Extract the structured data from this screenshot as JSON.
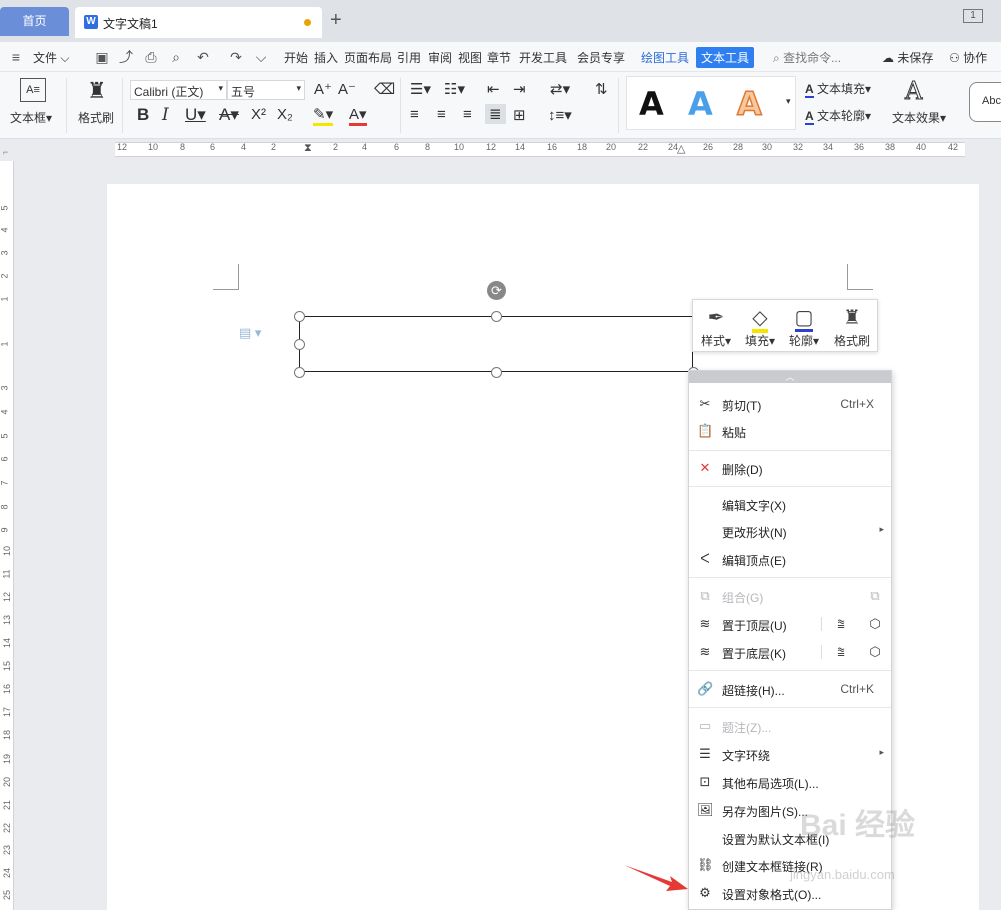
{
  "tabs": {
    "home": "首页",
    "document": "文字文稿1",
    "add": "+",
    "page_indicator": "1"
  },
  "menubar": {
    "file": "文件",
    "items": [
      "开始",
      "插入",
      "页面布局",
      "引用",
      "审阅",
      "视图",
      "章节",
      "开发工具",
      "会员专享"
    ],
    "drawing_tools": "绘图工具",
    "text_tools": "文本工具",
    "search": "查找命令...",
    "unsaved": "未保存",
    "collab": "协作"
  },
  "ribbon": {
    "textbox_label": "文本框",
    "format_painter_label": "格式刷",
    "font_name": "Calibri (正文)",
    "font_size": "五号",
    "text_fill": "文本填充",
    "text_outline": "文本轮廓",
    "text_effect": "文本效果",
    "style_letter": "A",
    "abc": "Abc"
  },
  "ruler": {
    "h_numbers": [
      "12",
      "10",
      "8",
      "6",
      "4",
      "2",
      "2",
      "4",
      "6",
      "8",
      "10",
      "12",
      "14",
      "16",
      "18",
      "20",
      "22",
      "24",
      "26",
      "28",
      "30",
      "32",
      "34",
      "36",
      "38",
      "40",
      "42"
    ],
    "v_numbers": [
      "5",
      "4",
      "3",
      "2",
      "1",
      "1",
      "3",
      "4",
      "5",
      "6",
      "7",
      "8",
      "9",
      "10",
      "11",
      "12",
      "13",
      "14",
      "15",
      "16",
      "17",
      "18",
      "19",
      "20",
      "21",
      "22",
      "23",
      "24",
      "25"
    ]
  },
  "mini_toolbar": {
    "style": "样式",
    "fill": "填充",
    "outline": "轮廓",
    "painter": "格式刷"
  },
  "context_menu": {
    "cut": "剪切(T)",
    "cut_shortcut": "Ctrl+X",
    "paste": "粘贴",
    "delete": "删除(D)",
    "edit_text": "编辑文字(X)",
    "change_shape": "更改形状(N)",
    "edit_points": "编辑顶点(E)",
    "group": "组合(G)",
    "bring_front": "置于顶层(U)",
    "send_back": "置于底层(K)",
    "hyperlink": "超链接(H)...",
    "hyperlink_shortcut": "Ctrl+K",
    "caption": "题注(Z)...",
    "text_wrap": "文字环绕",
    "other_layout": "其他布局选项(L)...",
    "save_as_picture": "另存为图片(S)...",
    "set_default": "设置为默认文本框(I)",
    "create_link": "创建文本框链接(R)",
    "format_object": "设置对象格式(O)..."
  },
  "watermark": {
    "text": "Bai 经验",
    "url": "jingyan.baidu.com"
  },
  "colors": {
    "accent": "#2f7ff0",
    "home_tab": "#6a8fd8",
    "arrow": "#e53935"
  }
}
